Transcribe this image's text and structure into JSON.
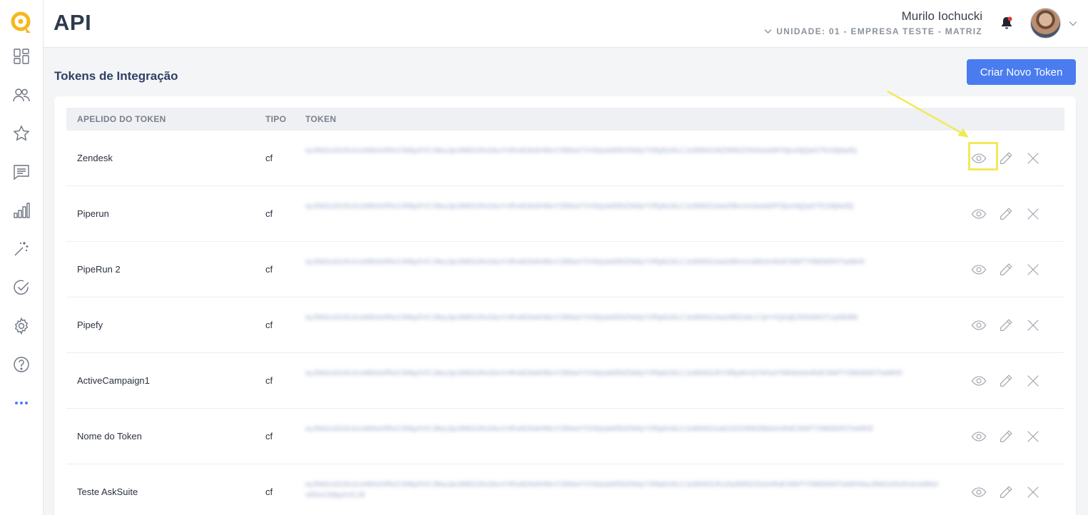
{
  "header": {
    "title": "API",
    "user_name": "Murilo Iochucki",
    "unit": "UNIDADE: 01 - EMPRESA TESTE - MATRIZ"
  },
  "sidebar": {
    "items": [
      {
        "name": "dashboard",
        "icon": "dashboard-grid-icon"
      },
      {
        "name": "contacts",
        "icon": "users-icon"
      },
      {
        "name": "favorites",
        "icon": "star-icon"
      },
      {
        "name": "messages",
        "icon": "chat-icon"
      },
      {
        "name": "reports",
        "icon": "bar-chart-icon"
      },
      {
        "name": "automation",
        "icon": "magic-wand-icon"
      },
      {
        "name": "tasks",
        "icon": "check-circle-icon"
      },
      {
        "name": "settings",
        "icon": "gear-icon"
      },
      {
        "name": "help",
        "icon": "help-circle-icon"
      },
      {
        "name": "more",
        "icon": "more-dots-icon"
      }
    ]
  },
  "section": {
    "title": "Tokens de Integração",
    "create_button": "Criar Novo Token"
  },
  "table": {
    "columns": [
      "APELIDO DO TOKEN",
      "TIPO",
      "TOKEN"
    ],
    "rows": [
      {
        "name": "Zendesk",
        "type": "cf",
        "token": "eyJhbGciOiJIUzUxMiIsInR5cCI6IkpXVCJ9eyJpc3MiOiJhcGkuYnRvdG9vbHMuY29tIiwiYXVkIjoiaW50ZWdyYXRpb24iLCJzdWIiOiJ6ZW5kZXNrIiwiaWF0IjoxNjQwOTk1MjAwfQ"
      },
      {
        "name": "Piperun",
        "type": "cf",
        "token": "eyJhbGciOiJIUzUxMiIsInR5cCI6IkpXVCJ9eyJpc3MiOiJhcGkuYnRvdG9vbHMuY29tIiwiYXVkIjoiaW50ZWdyYXRpb24iLCJzdWIiOiJwaXBlcnVuIiwiaWF0IjoxNjQwOTk1MjAwfQ"
      },
      {
        "name": "PipeRun 2",
        "type": "cf",
        "token": "eyJhbGciOiJIUzUxMiIsInR5cCI6IkpXVCJ9eyJpc3MiOiJhcGkuYnRvdG9vbHMuY29tIiwiYXVkIjoiaW50ZWdyYXRpb24iLCJzdWIiOiJwaXBlcnVuMiIsImlhdCI6MTY0MDk5NTIwMH0"
      },
      {
        "name": "Pipefy",
        "type": "cf",
        "token": "eyJhbGciOiJIUzUxMiIsInR5cCI6IkpXVCJ9eyJpc3MiOiJhcGkuYnRvdG9vbHMuY29tIiwiYXVkIjoiaW50ZWdyYXRpb24iLCJzdWIiOiJwaXBlZnkiLCJpYXQiOjE2NDA5OTUyMDB9"
      },
      {
        "name": "ActiveCampaign1",
        "type": "cf",
        "token": "eyJhbGciOiJIUzUxMiIsInR5cCI6IkpXVCJ9eyJpc3MiOiJhcGkuYnRvdG9vbHMuY29tIiwiYXVkIjoiaW50ZWdyYXRpb24iLCJzdWIiOiJhY3RpdmVjYW1wYWlnbiIsImlhdCI6MTY0MDk5NTIwMH0"
      },
      {
        "name": "Nome do Token",
        "type": "cf",
        "token": "eyJhbGciOiJIUzUxMiIsInR5cCI6IkpXVCJ9eyJpc3MiOiJhcGkuYnRvdG9vbHMuY29tIiwiYXVkIjoiaW50ZWdyYXRpb24iLCJzdWIiOiJub21lZG90b2tlbiIsImlhdCI6MTY0MDk5NTIwMH0"
      },
      {
        "name": "Teste AskSuite",
        "type": "cf",
        "token": "eyJhbGciOiJIUzUxMiIsInR5cCI6IkpXVCJ9eyJpc3MiOiJhcGkuYnRvdG9vbHMuY29tIiwiYXVkIjoiaW50ZWdyYXRpb24iLCJzdWIiOiJhc2tzdWl0ZSIsImlhdCI6MTY0MDk5NTIwMH0eyJhbGciOiJIUzUxMiIsInR5cCI6IkpXVCJ9"
      }
    ]
  },
  "colors": {
    "accent": "#4a7cf0",
    "logo": "#f5b81c",
    "highlight": "#f0ea5a",
    "notification": "#e53935"
  }
}
